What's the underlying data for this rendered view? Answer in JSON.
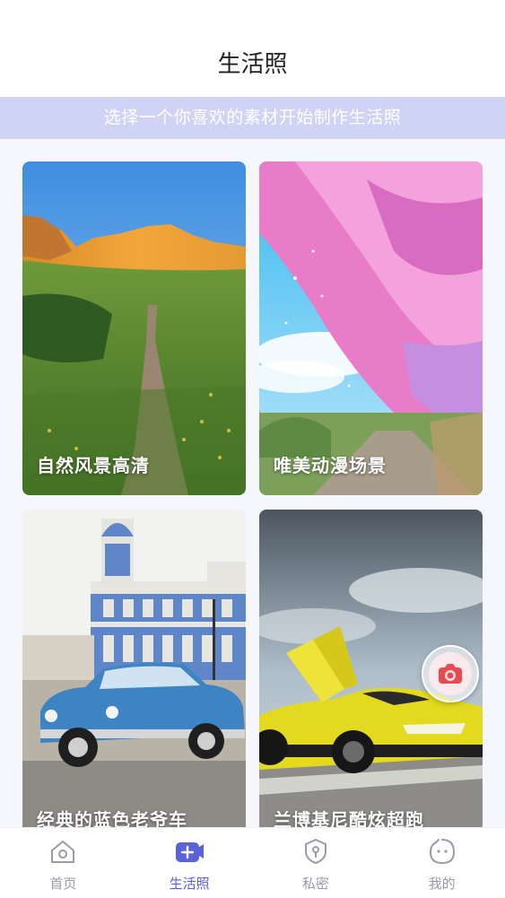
{
  "header": {
    "title": "生活照"
  },
  "banner": {
    "text": "选择一个你喜欢的素材开始制作生活照"
  },
  "cards": [
    {
      "label": "自然风景高清"
    },
    {
      "label": "唯美动漫场景"
    },
    {
      "label": "经典的蓝色老爷车"
    },
    {
      "label": "兰博基尼酷炫超跑"
    }
  ],
  "tabs": [
    {
      "label": "首页",
      "icon": "home-icon",
      "active": false
    },
    {
      "label": "生活照",
      "icon": "photo-plus-icon",
      "active": true
    },
    {
      "label": "私密",
      "icon": "shield-icon",
      "active": false
    },
    {
      "label": "我的",
      "icon": "face-icon",
      "active": false
    }
  ],
  "colors": {
    "banner_bg": "#cfd3f6",
    "accent": "#5a62d8",
    "tab_inactive": "#9a9aa6",
    "camera_red": "#e84a4f"
  }
}
